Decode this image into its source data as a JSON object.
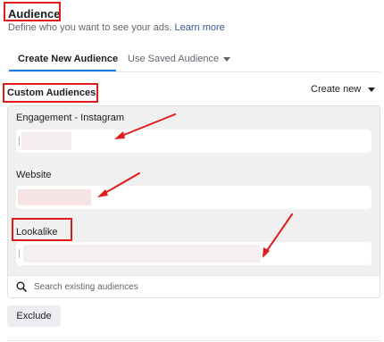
{
  "header": {
    "title": "Audience",
    "subtitle": "Define who you want to see your ads.",
    "learn_more": "Learn more"
  },
  "tabs": [
    {
      "label": "Create New Audience",
      "active": true
    },
    {
      "label": "Use Saved Audience",
      "active": false
    }
  ],
  "custom_audiences": {
    "label": "Custom Audiences",
    "create_new": "Create new"
  },
  "rows": [
    {
      "label": "Engagement - Instagram"
    },
    {
      "label": "Website"
    },
    {
      "label": "Lookalike"
    }
  ],
  "search": {
    "placeholder": "Search existing audiences"
  },
  "exclude": {
    "label": "Exclude"
  },
  "colors": {
    "accent": "#1877f2",
    "annotation": "#e11b1b",
    "link": "#385898"
  },
  "icons": {
    "search": "search-icon",
    "caret": "caret-down-icon"
  }
}
